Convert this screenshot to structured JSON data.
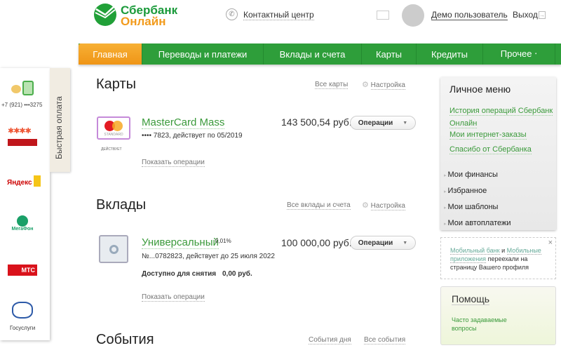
{
  "header": {
    "logo_line1": "Сбербанк",
    "logo_line2": "Онлайн",
    "contact_center": "Контактный центр",
    "user_name": "Демо пользователь",
    "logout": "Выход"
  },
  "nav": {
    "tabs": [
      "Главная",
      "Переводы и платежи",
      "Вклады и счета",
      "Карты",
      "Кредиты",
      "Прочее ‧"
    ]
  },
  "quick_pay": {
    "tab_label": "Быстрая оплата",
    "phone": "+7 (921) •••3275",
    "yandex": "Яндекс",
    "megafon": "МегаФон",
    "mts": "МТС",
    "gosuslugi": "Госуслуги"
  },
  "cards": {
    "title": "Карты",
    "all_link": "Все карты",
    "settings": "Настройка",
    "items": [
      {
        "name": "MasterCard Mass",
        "details": "•••• 7823, действует по 05/2019",
        "status": "ДЕЙСТВУЕТ",
        "amount": "143 500,54 руб.",
        "ops_button": "Операции",
        "show_ops": "Показать операции",
        "card_label": "STANDARD"
      }
    ]
  },
  "deposits": {
    "title": "Вклады",
    "all_link": "Все вклады и счета",
    "settings": "Настройка",
    "items": [
      {
        "name": "Универсальный",
        "rate": "0,01%",
        "details": "№...0782823, действует до 25 июля 2022",
        "available_label": "Доступно для снятия",
        "available_amount": "0,00 руб.",
        "amount": "100 000,00 руб.",
        "ops_button": "Операции",
        "show_ops": "Показать операции"
      }
    ]
  },
  "events": {
    "title": "События",
    "day_link": "События дня",
    "all_link": "Все события"
  },
  "personal_menu": {
    "title": "Личное меню",
    "links": [
      "История операций Сбербанк Онлайн",
      "Мои интернет-заказы",
      "Спасибо от Сбербанка"
    ],
    "items": [
      "Мои финансы",
      "Избранное",
      "Мои шаблоны",
      "Мои автоплатежи"
    ]
  },
  "notice": {
    "link1": "Мобильный банк",
    "and": "и",
    "link2": "Мобильные приложения",
    "text": "переехали на страницу Вашего профиля"
  },
  "help": {
    "title": "Помощь",
    "faq": "Часто задаваемые вопросы"
  }
}
